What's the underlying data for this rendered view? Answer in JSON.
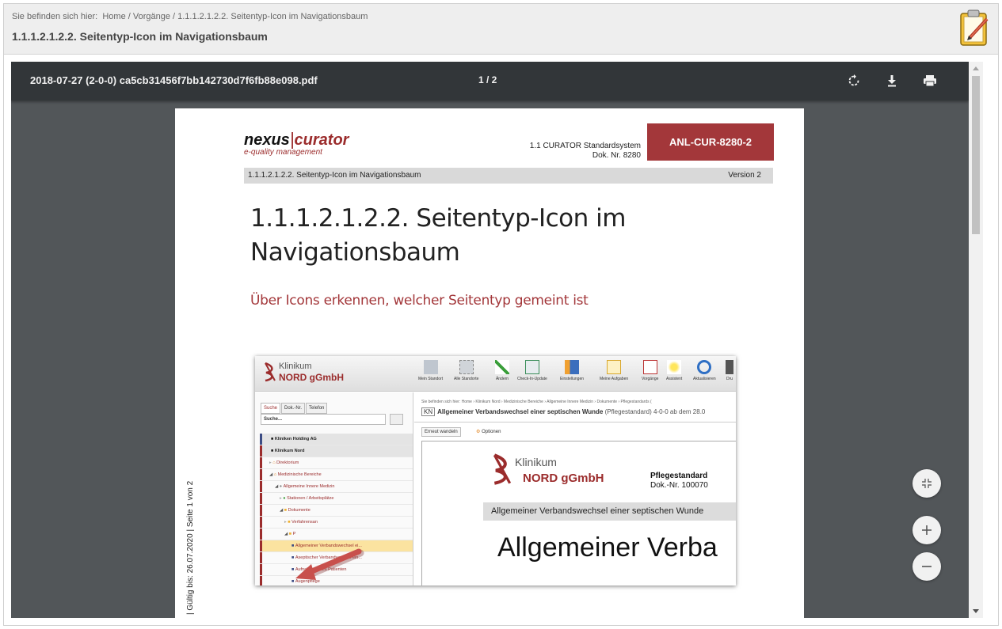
{
  "header": {
    "breadcrumb_prefix": "Sie befinden sich hier:",
    "breadcrumb_path": "Home / Vorgänge / 1.1.1.2.1.2.2. Seitentyp-Icon im Navigationsbaum",
    "title": "1.1.1.2.1.2.2. Seitentyp-Icon im Navigationsbaum",
    "edit_icon": "clipboard-pencil-icon"
  },
  "viewer": {
    "filename": "2018-07-27 (2-0-0) ca5cb31456f7bb142730d7f6fb88e098.pdf",
    "page_indicator": "1 / 2",
    "buttons": [
      "rotate-icon",
      "download-icon",
      "print-icon"
    ],
    "zoom_controls": [
      "fit-page-icon",
      "zoom-in-icon",
      "zoom-out-icon"
    ]
  },
  "document": {
    "brand_nexus": "nexus",
    "brand_bar": "|",
    "brand_curator": "curator",
    "brand_sub": "e-quality management",
    "system_name": "1.1 CURATOR Standardsystem",
    "doc_number": "Dok. Nr. 8280",
    "doc_id": "ANL-CUR-8280-2",
    "band_left": "1.1.1.2.1.2.2. Seitentyp-Icon im Navigationsbaum",
    "band_right": "Version 2",
    "title": "1.1.1.2.1.2.2. Seitentyp-Icon im Navigationsbaum",
    "subtitle": "Über Icons erkennen, welcher Seitentyp gemeint ist",
    "validity": "| Gültig bis: 26.07.2020 | Seite 1 von 2"
  },
  "screenshot": {
    "logo_line1": "Klinikum",
    "logo_line2": "NORD gGmbH",
    "toolbar": [
      "Mein Standort",
      "Alle Standorte",
      "Ändern",
      "Check-In-Update",
      "Einstellungen",
      "Meine Aufgaben",
      "Vorgänge",
      "Assistent",
      "Aktualisieren",
      "Dru"
    ],
    "tabs": [
      "Suche",
      "Dok.-Nr.",
      "Telefon"
    ],
    "search_placeholder": "Suche...",
    "tree": [
      "Kliniken Holding AG",
      "Klinikum Nord",
      "Direktorium",
      "Medizinische Bereiche",
      "Allgemeine Innere Medizin",
      "Stationen / Arbeitsplätze",
      "Dokumente",
      "Verfahrensan",
      "P",
      "Allgemeiner Verbandswechsel ei...",
      "Aseptischer Verbandwechsel ein...",
      "Aufnahme eines Patienten",
      "Augenpflege"
    ],
    "right_breadcrumb": "Sie befinden sich hier:  Home › Klinikum Nord › Medizinische Bereiche › Allgemeine Innere Medizin › Dokumente › Pflegestandards (",
    "right_kn": "KN",
    "right_title": "Allgemeiner Verbandswechsel einer septischen Wunde",
    "right_meta": "(Pflegestandard) 4-0-0 ab dem 28.0",
    "button_reedit": "Erneut wandeln",
    "button_options": "Optionen",
    "doc_klinikum": "Klinikum",
    "doc_nord": "NORD gGmbH",
    "doc_type": "Pflegestandard",
    "doc_nr": "Dok.-Nr. 100070",
    "doc_band": "Allgemeiner Verbandswechsel einer septischen Wunde",
    "doc_big": "Allgemeiner Verba"
  }
}
